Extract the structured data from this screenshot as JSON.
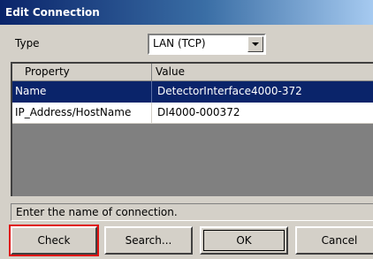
{
  "dialog": {
    "title": "Edit Connection"
  },
  "type_field": {
    "label": "Type",
    "selected": "LAN (TCP)"
  },
  "grid": {
    "columns": [
      "Property",
      "Value"
    ],
    "rows": [
      {
        "property": "Name",
        "value": "DetectorInterface4000-372",
        "selected": true
      },
      {
        "property": "IP_Address/HostName",
        "value": "DI4000-000372",
        "selected": false
      }
    ]
  },
  "status": {
    "text": "Enter the name of connection."
  },
  "buttons": {
    "check": "Check",
    "search": "Search...",
    "ok": "OK",
    "cancel": "Cancel"
  },
  "colors": {
    "selection": "#0a246a",
    "highlight_border": "#e01010",
    "face": "#d4d0c8"
  }
}
